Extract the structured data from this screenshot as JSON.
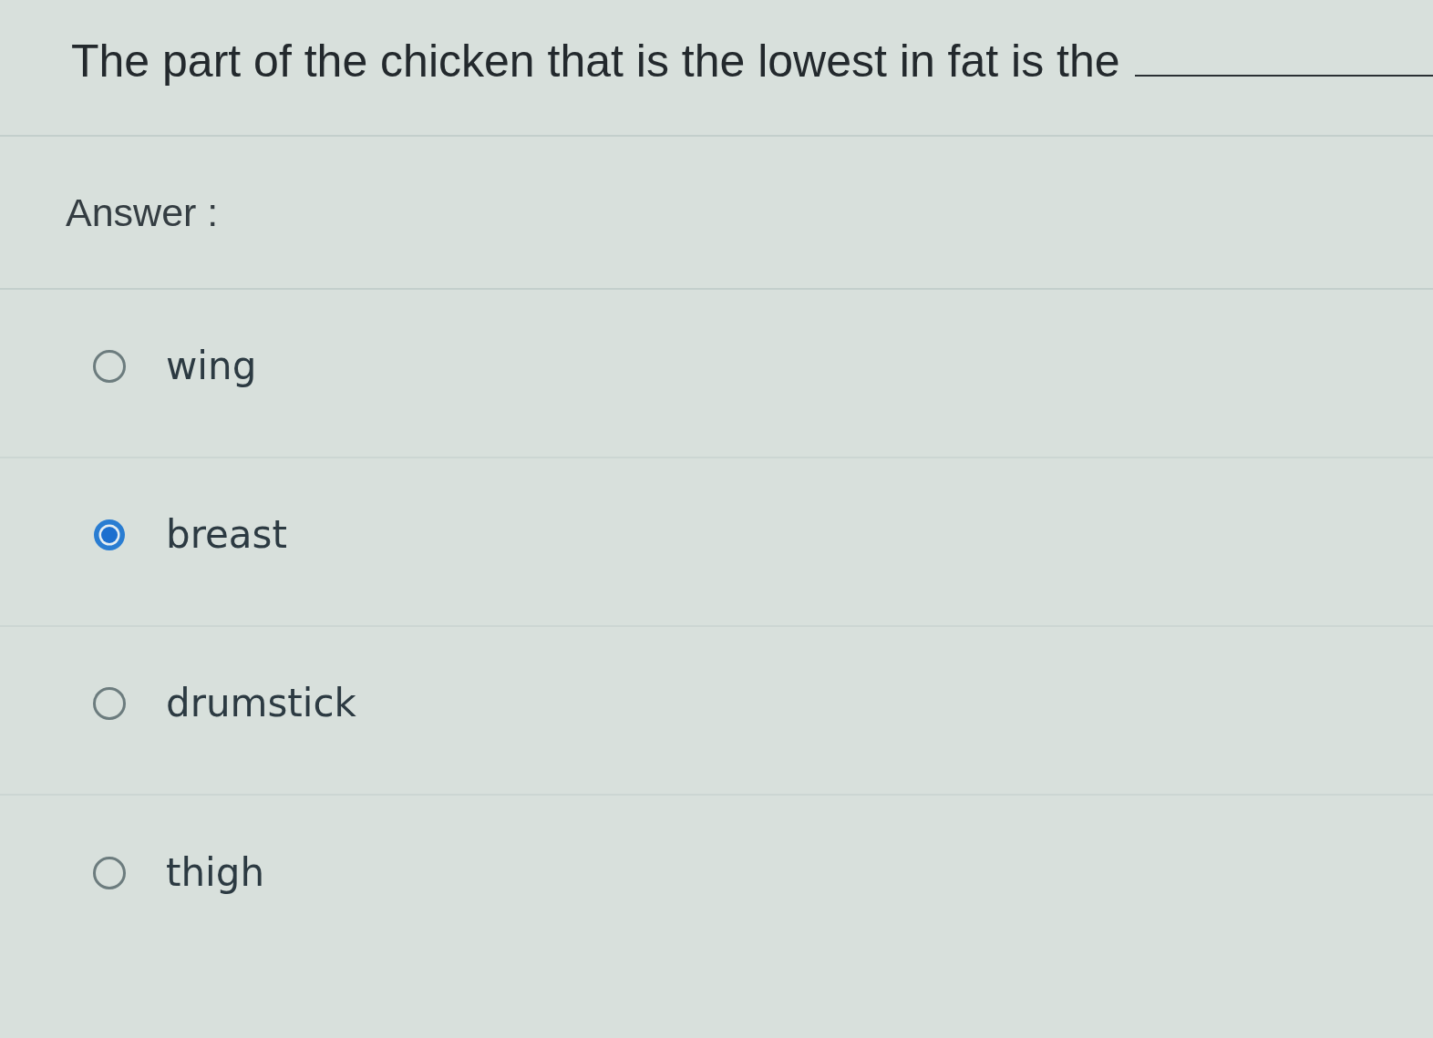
{
  "question": {
    "text": "The part of the chicken that is the lowest in fat is the"
  },
  "answer_label": "Answer :",
  "options": [
    {
      "label": "wing",
      "selected": false
    },
    {
      "label": "breast",
      "selected": true
    },
    {
      "label": "drumstick",
      "selected": false
    },
    {
      "label": "thigh",
      "selected": false
    }
  ]
}
